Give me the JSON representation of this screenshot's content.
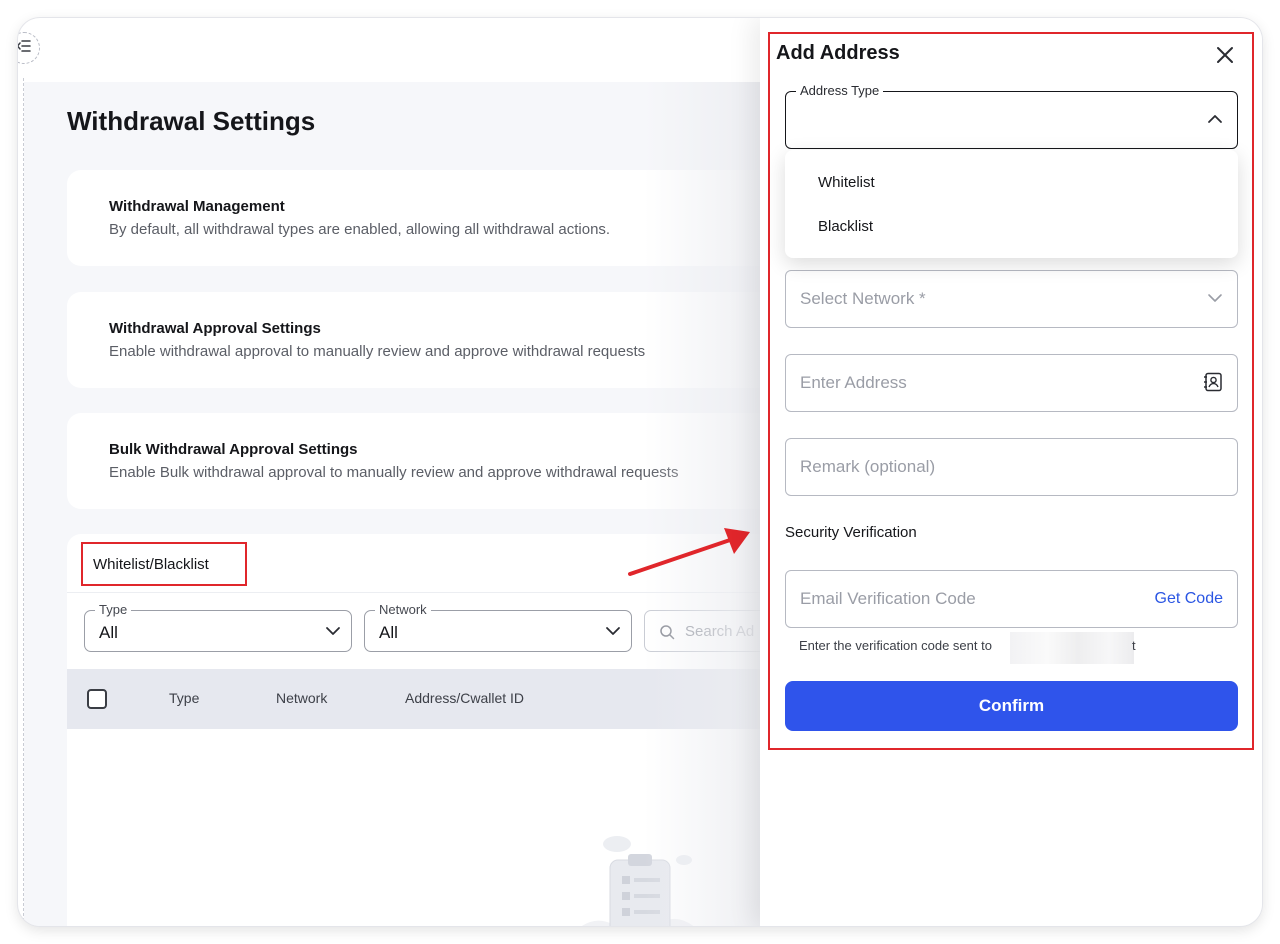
{
  "page": {
    "title": "Withdrawal Settings",
    "cards": [
      {
        "title": "Withdrawal Management",
        "description": "By default, all withdrawal types are enabled, allowing all withdrawal actions."
      },
      {
        "title": "Withdrawal Approval Settings",
        "description": "Enable withdrawal approval to manually review and approve withdrawal requests"
      },
      {
        "title": "Bulk Withdrawal Approval Settings",
        "description": "Enable Bulk withdrawal approval to manually review and approve withdrawal requests"
      }
    ]
  },
  "list": {
    "heading": "Whitelist/Blacklist",
    "filters": {
      "type": {
        "label": "Type",
        "value": "All"
      },
      "network": {
        "label": "Network",
        "value": "All"
      },
      "search_placeholder": "Search Ad"
    },
    "columns": [
      "Type",
      "Network",
      "Address/Cwallet ID"
    ]
  },
  "drawer": {
    "title": "Add Address",
    "address_type": {
      "label": "Address Type",
      "options": [
        "Whitelist",
        "Blacklist"
      ]
    },
    "network_placeholder": "Select Network *",
    "address_placeholder": "Enter Address",
    "remark_placeholder": "Remark (optional)",
    "security_label": "Security Verification",
    "email_code_placeholder": "Email Verification Code",
    "get_code": "Get Code",
    "hint_prefix": "Enter the verification code sent to",
    "hint_suffix": "t",
    "confirm": "Confirm"
  },
  "colors": {
    "accent": "#2f54eb",
    "highlight": "#e0262b",
    "link": "#2b56e3"
  },
  "icons": [
    "menu-collapse-icon",
    "chevron-down-icon",
    "chevron-up-icon",
    "search-icon",
    "close-icon",
    "contact-book-icon",
    "arrow-icon",
    "empty-clipboard-icon"
  ]
}
